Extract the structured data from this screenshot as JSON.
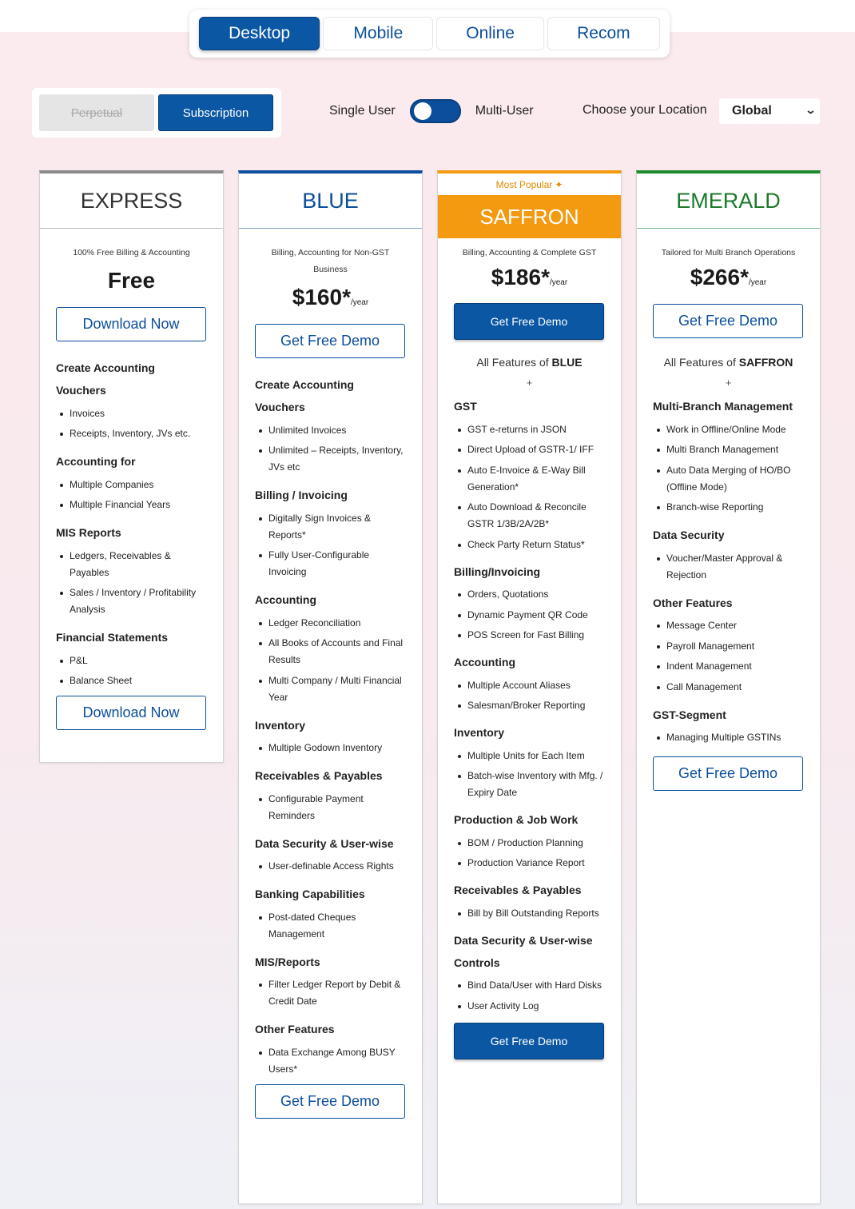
{
  "tabs": [
    "Desktop",
    "Mobile",
    "Online",
    "Recom"
  ],
  "license": {
    "perpetual": "Perpetual",
    "subscription": "Subscription"
  },
  "user_toggle": {
    "single": "Single User",
    "multi": "Multi-User"
  },
  "location": {
    "label": "Choose your Location",
    "selected": "Global"
  },
  "plans": {
    "express": {
      "name": "EXPRESS",
      "tagline": "100% Free Billing & Accounting",
      "price": "Free",
      "cta": "Download Now",
      "cta_bottom": "Download Now",
      "sections": [
        {
          "title": "Create Accounting Vouchers",
          "items": [
            "Invoices",
            "Receipts, Inventory, JVs etc."
          ]
        },
        {
          "title": "Accounting for",
          "items": [
            "Multiple Companies",
            "Multiple Financial Years"
          ]
        },
        {
          "title": "MIS Reports",
          "items": [
            "Ledgers, Receivables & Payables",
            "Sales / Inventory / Profitability Analysis"
          ]
        },
        {
          "title": "Financial Statements",
          "items": [
            "P&L",
            "Balance Sheet"
          ]
        }
      ]
    },
    "blue": {
      "name": "BLUE",
      "tagline": "Billing, Accounting for Non-GST Business",
      "price": "$160*",
      "per": "/year",
      "cta": "Get Free Demo",
      "cta_bottom": "Get Free Demo",
      "sections": [
        {
          "title": "Create Accounting Vouchers",
          "items": [
            "Unlimited Invoices",
            "Unlimited – Receipts, Inventory, JVs etc"
          ]
        },
        {
          "title": "Billing / Invoicing",
          "items": [
            "Digitally Sign Invoices & Reports*",
            "Fully User-Configurable Invoicing"
          ]
        },
        {
          "title": "Accounting",
          "items": [
            "Ledger Reconciliation",
            "All Books of Accounts and Final Results",
            "Multi Company / Multi Financial Year"
          ]
        },
        {
          "title": "Inventory",
          "items": [
            "Multiple Godown Inventory"
          ]
        },
        {
          "title": "Receivables & Payables",
          "items": [
            "Configurable Payment Reminders"
          ]
        },
        {
          "title": "Data Security & User-wise",
          "items": [
            "User-definable Access Rights"
          ]
        },
        {
          "title": "Banking Capabilities",
          "items": [
            "Post-dated Cheques Management"
          ]
        },
        {
          "title": "MIS/Reports",
          "items": [
            "Filter Ledger Report by Debit & Credit Date"
          ]
        },
        {
          "title": "Other Features",
          "items": [
            "Data Exchange Among BUSY Users*"
          ]
        }
      ]
    },
    "saffron": {
      "badge": "Most Popular",
      "name": "SAFFRON",
      "tagline": "Billing, Accounting & Complete GST",
      "price": "$186*",
      "per": "/year",
      "cta": "Get Free Demo",
      "cta_bottom": "Get Free Demo",
      "all_of_prefix": "All Features of",
      "all_of_plan": "BLUE",
      "plus": "+",
      "sections": [
        {
          "title": "GST",
          "items": [
            "GST e-returns in JSON",
            "Direct Upload of GSTR-1/ IFF",
            "Auto E-Invoice & E-Way Bill Generation*",
            "Auto Download & Reconcile GSTR 1/3B/2A/2B*",
            "Check Party Return Status*"
          ]
        },
        {
          "title": "Billing/Invoicing",
          "items": [
            "Orders, Quotations",
            "Dynamic Payment QR Code",
            "POS Screen for Fast Billing"
          ]
        },
        {
          "title": "Accounting",
          "items": [
            "Multiple Account Aliases",
            "Salesman/Broker Reporting"
          ]
        },
        {
          "title": "Inventory",
          "items": [
            "Multiple Units for Each Item",
            "Batch-wise Inventory with Mfg. / Expiry Date"
          ]
        },
        {
          "title": "Production & Job Work",
          "items": [
            "BOM / Production Planning",
            "Production Variance Report"
          ]
        },
        {
          "title": "Receivables & Payables",
          "items": [
            "Bill by Bill Outstanding Reports"
          ]
        },
        {
          "title": "Data Security & User-wise Controls",
          "items": [
            "Bind Data/User with Hard Disks",
            "User Activity Log"
          ]
        }
      ]
    },
    "emerald": {
      "name": "EMERALD",
      "tagline": "Tailored for Multi Branch Operations",
      "price": "$266*",
      "per": "/year",
      "cta": "Get Free Demo",
      "cta_bottom": "Get Free Demo",
      "all_of_prefix": "All Features of",
      "all_of_plan": "SAFFRON",
      "plus": "+",
      "sections": [
        {
          "title": "Multi-Branch Management",
          "items": [
            "Work in Offline/Online Mode",
            "Multi Branch Management",
            "Auto Data Merging of HO/BO (Offline Mode)",
            "Branch-wise Reporting"
          ]
        },
        {
          "title": "Data Security",
          "items": [
            "Voucher/Master Approval & Rejection"
          ]
        },
        {
          "title": "Other Features",
          "items": [
            "Message Center",
            "Payroll Management",
            "Indent Management",
            "Call Management"
          ]
        },
        {
          "title": "GST-Segment",
          "items": [
            "Managing Multiple GSTINs"
          ]
        }
      ]
    }
  },
  "colors": {
    "primary": "#0b57a4",
    "saffron": "#f39a11",
    "emerald": "#1b7a2a",
    "express_border": "#8a8a8a"
  }
}
